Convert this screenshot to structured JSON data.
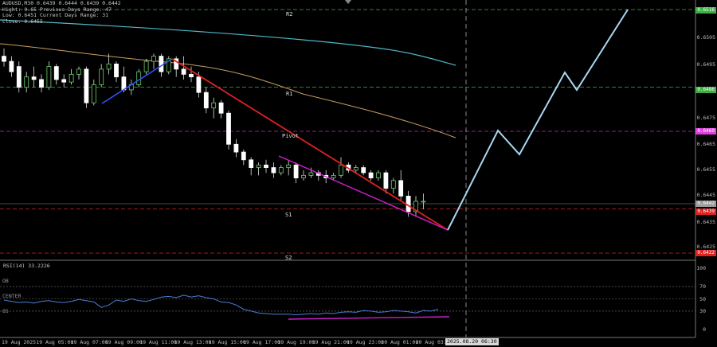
{
  "header": {
    "symbol_line": "AUDUSD,M30  0.6439 0.6444 0.6439 0.6442",
    "line2": "Hight: 0.65   Previous Days Range: 47",
    "line3": "Low: 0.6451   Current Days Range: 31",
    "line4": "Close: 0.6455"
  },
  "levels": {
    "r2": "R2",
    "r1": "R1",
    "pivot": "Pivot",
    "s1": "S1",
    "s2": "S2"
  },
  "price_axis": [
    "0.6516",
    "0.6505",
    "0.6495",
    "0.6485",
    "0.6475",
    "0.6465",
    "0.6455",
    "0.6445",
    "0.6435",
    "0.6425"
  ],
  "price_tags": [
    {
      "text": "0.6516",
      "color": "#3cb043"
    },
    {
      "text": "0.6486",
      "color": "#3cb043"
    },
    {
      "text": "0.6469",
      "color": "#e040e0"
    },
    {
      "text": "0.6442",
      "color": "#9a9a9a"
    },
    {
      "text": "0.6439",
      "color": "#e02020"
    },
    {
      "text": "0.6422",
      "color": "#e02020"
    }
  ],
  "time_axis": [
    "19 Aug 2025",
    "19 Aug 05:00",
    "19 Aug 07:00",
    "19 Aug 09:00",
    "19 Aug 11:00",
    "19 Aug 13:00",
    "19 Aug 15:00",
    "19 Aug 17:00",
    "19 Aug 19:00",
    "19 Aug 21:00",
    "19 Aug 23:00",
    "20 Aug 01:00",
    "20 Aug 03:00"
  ],
  "current_time": "2025.08.20 06:30",
  "rsi": {
    "title": "RSI(14) 33.2226",
    "ob": "OB",
    "center": "CENTER",
    "os": "OS",
    "axis": [
      "100",
      "70",
      "50",
      "30",
      "0"
    ]
  },
  "chart_data": {
    "type": "candlestick",
    "symbol": "AUDUSD",
    "timeframe": "M30",
    "y_range": [
      0.642,
      0.652
    ],
    "candles": [
      [
        0.6498,
        0.6501,
        0.6494,
        0.6496
      ],
      [
        0.6496,
        0.6498,
        0.649,
        0.6492
      ],
      [
        0.6494,
        0.6496,
        0.6484,
        0.6486
      ],
      [
        0.6486,
        0.6492,
        0.6484,
        0.649
      ],
      [
        0.649,
        0.6494,
        0.6486,
        0.6489
      ],
      [
        0.6489,
        0.6491,
        0.6484,
        0.6486
      ],
      [
        0.6486,
        0.6496,
        0.6485,
        0.6494
      ],
      [
        0.6494,
        0.6495,
        0.6487,
        0.6489
      ],
      [
        0.6489,
        0.6491,
        0.6486,
        0.6488
      ],
      [
        0.6488,
        0.6493,
        0.6487,
        0.6491
      ],
      [
        0.6491,
        0.6494,
        0.6489,
        0.6493
      ],
      [
        0.6493,
        0.6494,
        0.6478,
        0.648
      ],
      [
        0.648,
        0.6489,
        0.6479,
        0.6487
      ],
      [
        0.6487,
        0.6495,
        0.6486,
        0.6493
      ],
      [
        0.6493,
        0.6499,
        0.6491,
        0.6495
      ],
      [
        0.6495,
        0.6496,
        0.6488,
        0.649
      ],
      [
        0.649,
        0.6494,
        0.6484,
        0.6485
      ],
      [
        0.6485,
        0.6489,
        0.6483,
        0.6487
      ],
      [
        0.6487,
        0.6493,
        0.6486,
        0.6492
      ],
      [
        0.6492,
        0.6497,
        0.6491,
        0.6496
      ],
      [
        0.6496,
        0.6499,
        0.6493,
        0.6498
      ],
      [
        0.6498,
        0.6499,
        0.649,
        0.6492
      ],
      [
        0.6492,
        0.6498,
        0.6491,
        0.6497
      ],
      [
        0.6497,
        0.6498,
        0.649,
        0.6493
      ],
      [
        0.6493,
        0.6498,
        0.6489,
        0.6491
      ],
      [
        0.6491,
        0.6494,
        0.6488,
        0.649
      ],
      [
        0.649,
        0.6492,
        0.6482,
        0.6484
      ],
      [
        0.6484,
        0.6486,
        0.6476,
        0.6478
      ],
      [
        0.6478,
        0.6482,
        0.6474,
        0.648
      ],
      [
        0.648,
        0.6481,
        0.6474,
        0.6476
      ],
      [
        0.6476,
        0.6477,
        0.6462,
        0.6464
      ],
      [
        0.6464,
        0.6466,
        0.6459,
        0.6461
      ],
      [
        0.6461,
        0.6462,
        0.6456,
        0.6458
      ],
      [
        0.6458,
        0.6459,
        0.6452,
        0.6455
      ],
      [
        0.6455,
        0.6457,
        0.6452,
        0.6456
      ],
      [
        0.6456,
        0.6458,
        0.6453,
        0.6455
      ],
      [
        0.6455,
        0.6457,
        0.6451,
        0.6453
      ],
      [
        0.6453,
        0.6456,
        0.6452,
        0.6455
      ],
      [
        0.6455,
        0.6458,
        0.6452,
        0.6456
      ],
      [
        0.6456,
        0.6457,
        0.6449,
        0.6451
      ],
      [
        0.6451,
        0.6454,
        0.645,
        0.6452
      ],
      [
        0.6452,
        0.6455,
        0.6451,
        0.6453
      ],
      [
        0.6453,
        0.6454,
        0.645,
        0.6452
      ],
      [
        0.6452,
        0.6454,
        0.6449,
        0.6451
      ],
      [
        0.6451,
        0.6453,
        0.645,
        0.6452
      ],
      [
        0.6452,
        0.6459,
        0.6451,
        0.6456
      ],
      [
        0.6456,
        0.6457,
        0.6453,
        0.6454
      ],
      [
        0.6454,
        0.6456,
        0.6453,
        0.6455
      ],
      [
        0.6455,
        0.6456,
        0.6452,
        0.6453
      ],
      [
        0.6453,
        0.6454,
        0.645,
        0.6451
      ],
      [
        0.6451,
        0.6454,
        0.645,
        0.6453
      ],
      [
        0.6453,
        0.6454,
        0.6445,
        0.6447
      ],
      [
        0.6447,
        0.6451,
        0.6445,
        0.645
      ],
      [
        0.645,
        0.6454,
        0.6442,
        0.6444
      ],
      [
        0.6444,
        0.6446,
        0.6436,
        0.6438
      ],
      [
        0.6438,
        0.6444,
        0.6436,
        0.6442
      ],
      [
        0.6442,
        0.6445,
        0.6439,
        0.6442
      ]
    ],
    "ma_slow": [
      0.6513,
      0.651,
      0.6504,
      0.6495
    ],
    "ma_fast": [
      0.6497,
      0.6493,
      0.6482,
      0.6467
    ],
    "pivot_levels": {
      "R2": 0.6516,
      "R1": 0.6486,
      "Pivot": 0.6469,
      "S1": 0.6439,
      "S2": 0.6422
    },
    "trend_lines": [
      {
        "color": "#3050ff",
        "from": [
          0.6481
        ],
        "to": [
          0.6496
        ]
      },
      {
        "color": "#e02020",
        "from": [
          0.6496
        ],
        "to": [
          0.6433
        ]
      },
      {
        "color": "#d020d0",
        "from": [
          0.6456
        ],
        "to": [
          0.6433
        ]
      }
    ],
    "projection": [
      0.6433,
      0.6469,
      0.646,
      0.6489,
      0.6483,
      0.6516
    ],
    "rsi_values": [
      48,
      46,
      44,
      45,
      43,
      46,
      47,
      45,
      44,
      46,
      49,
      47,
      45,
      36,
      40,
      48,
      46,
      50,
      47,
      46,
      49,
      53,
      54,
      52,
      56,
      53,
      55,
      52,
      50,
      45,
      44,
      40,
      33,
      30,
      27,
      26,
      25,
      25,
      25,
      24,
      25,
      26,
      25,
      27,
      26,
      28,
      29,
      28,
      31,
      30,
      28,
      29,
      31,
      30,
      29,
      27,
      31,
      30,
      33
    ],
    "rsi_levels": {
      "OB": 70,
      "CENTER": 50,
      "OS": 30
    }
  }
}
